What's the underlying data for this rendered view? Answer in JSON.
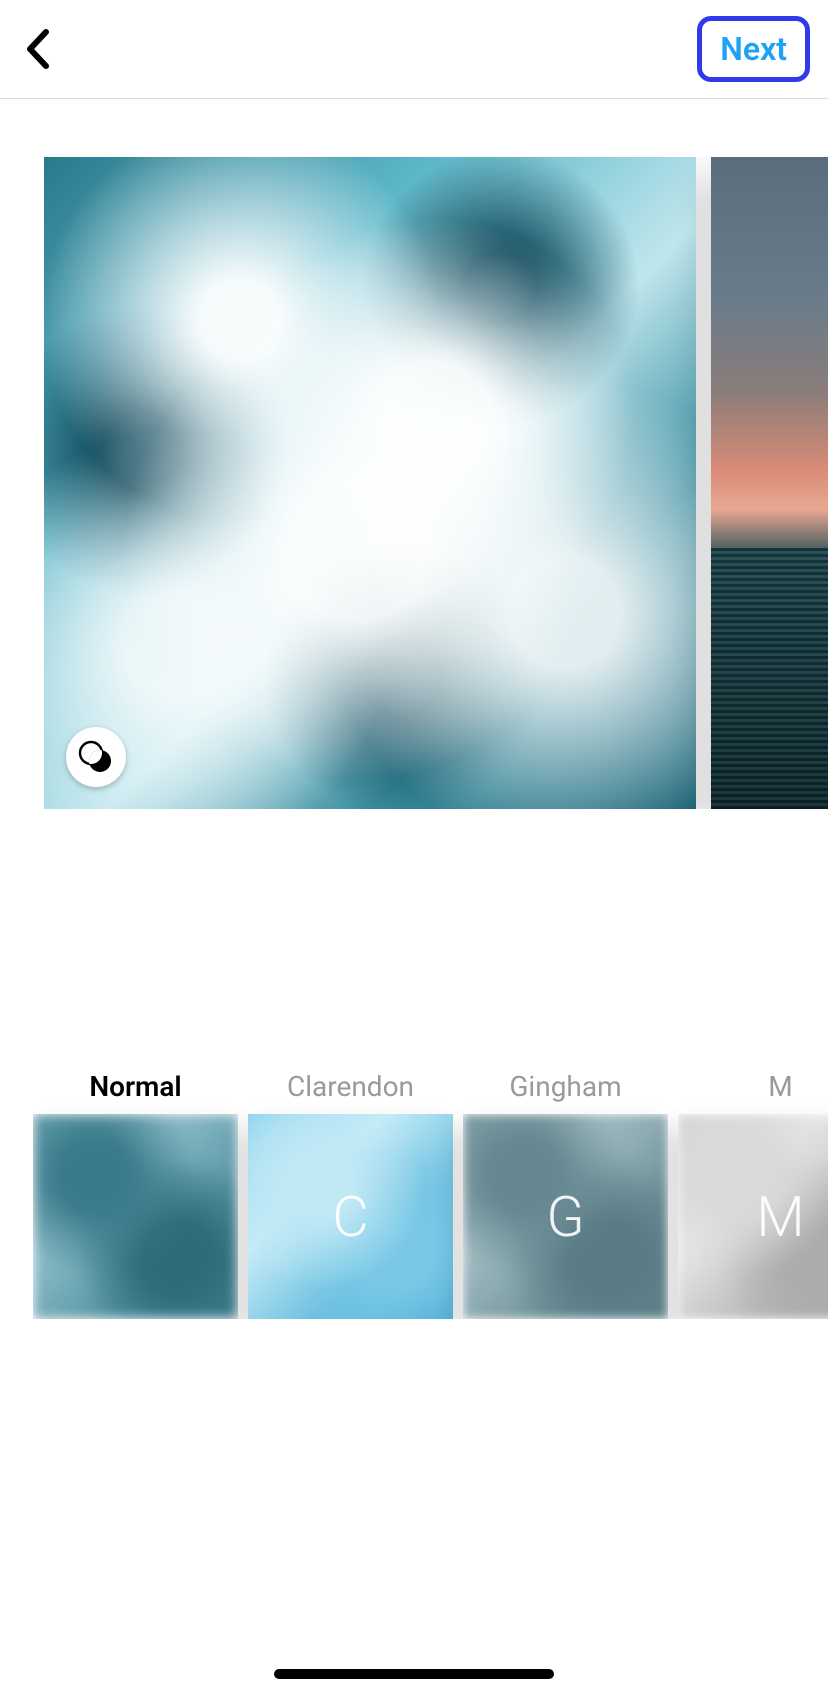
{
  "header": {
    "next_label": "Next"
  },
  "previews": [
    {
      "name": "ocean-waves",
      "lux_icon": "venn-contrast-icon"
    },
    {
      "name": "sunset-sea",
      "lux_icon": "venn-contrast-icon"
    }
  ],
  "filters": [
    {
      "label": "Normal",
      "selected": true,
      "letter": ""
    },
    {
      "label": "Clarendon",
      "selected": false,
      "letter": "C"
    },
    {
      "label": "Gingham",
      "selected": false,
      "letter": "G"
    },
    {
      "label": "M",
      "selected": false,
      "letter": "M"
    }
  ]
}
